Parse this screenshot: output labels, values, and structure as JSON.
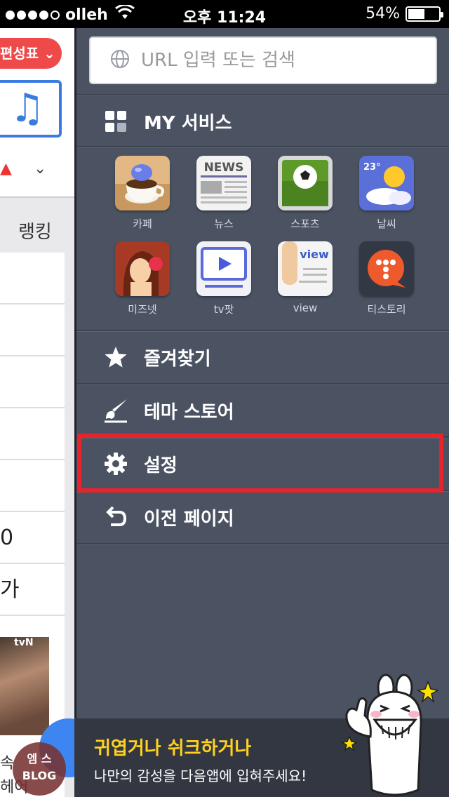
{
  "status_bar": {
    "signal_dots_filled": 4,
    "carrier": "olleh",
    "time": "오후 11:24",
    "battery_percent": "54%",
    "battery_level": 0.54
  },
  "background_page": {
    "dropdown_label": "편성표",
    "tab_label": "랭킹",
    "row_fragments": [
      "0",
      "가"
    ],
    "photo_tag": "tvN",
    "text_fragments": [
      "속",
      "헤어"
    ],
    "blog_badge_line1": "엠 스",
    "blog_badge_line2": "BLOG"
  },
  "menu": {
    "url_placeholder": "URL 입력 또는 검색",
    "my_services": {
      "label": "MY 서비스",
      "icon": "grid-icon"
    },
    "apps": [
      {
        "label": "카페",
        "icon": "cafe-icon"
      },
      {
        "label": "뉴스",
        "icon": "news-icon",
        "tile_text": "NEWS"
      },
      {
        "label": "스포츠",
        "icon": "sports-icon"
      },
      {
        "label": "날씨",
        "icon": "weather-icon",
        "tile_text": "23°"
      },
      {
        "label": "미즈넷",
        "icon": "miznet-icon"
      },
      {
        "label": "tv팟",
        "icon": "tvpot-icon"
      },
      {
        "label": "view",
        "icon": "view-icon",
        "tile_text": "view"
      },
      {
        "label": "티스토리",
        "icon": "tistory-icon"
      }
    ],
    "items": [
      {
        "label": "즐겨찾기",
        "icon": "star-icon"
      },
      {
        "label": "테마 스토어",
        "icon": "brush-icon"
      },
      {
        "label": "설정",
        "icon": "gear-icon"
      },
      {
        "label": "이전 페이지",
        "icon": "back-arrow-icon"
      }
    ],
    "highlighted_item": "설정"
  },
  "promo": {
    "title": "귀엽거나 쉬크하거나",
    "subtitle": "나만의 감성을 다음앱에 입혀주세요!"
  },
  "colors": {
    "panel_bg": "#4b5363",
    "highlight_border": "#e8232b",
    "promo_title": "#ffd21f",
    "promo_bg": "#323741"
  }
}
